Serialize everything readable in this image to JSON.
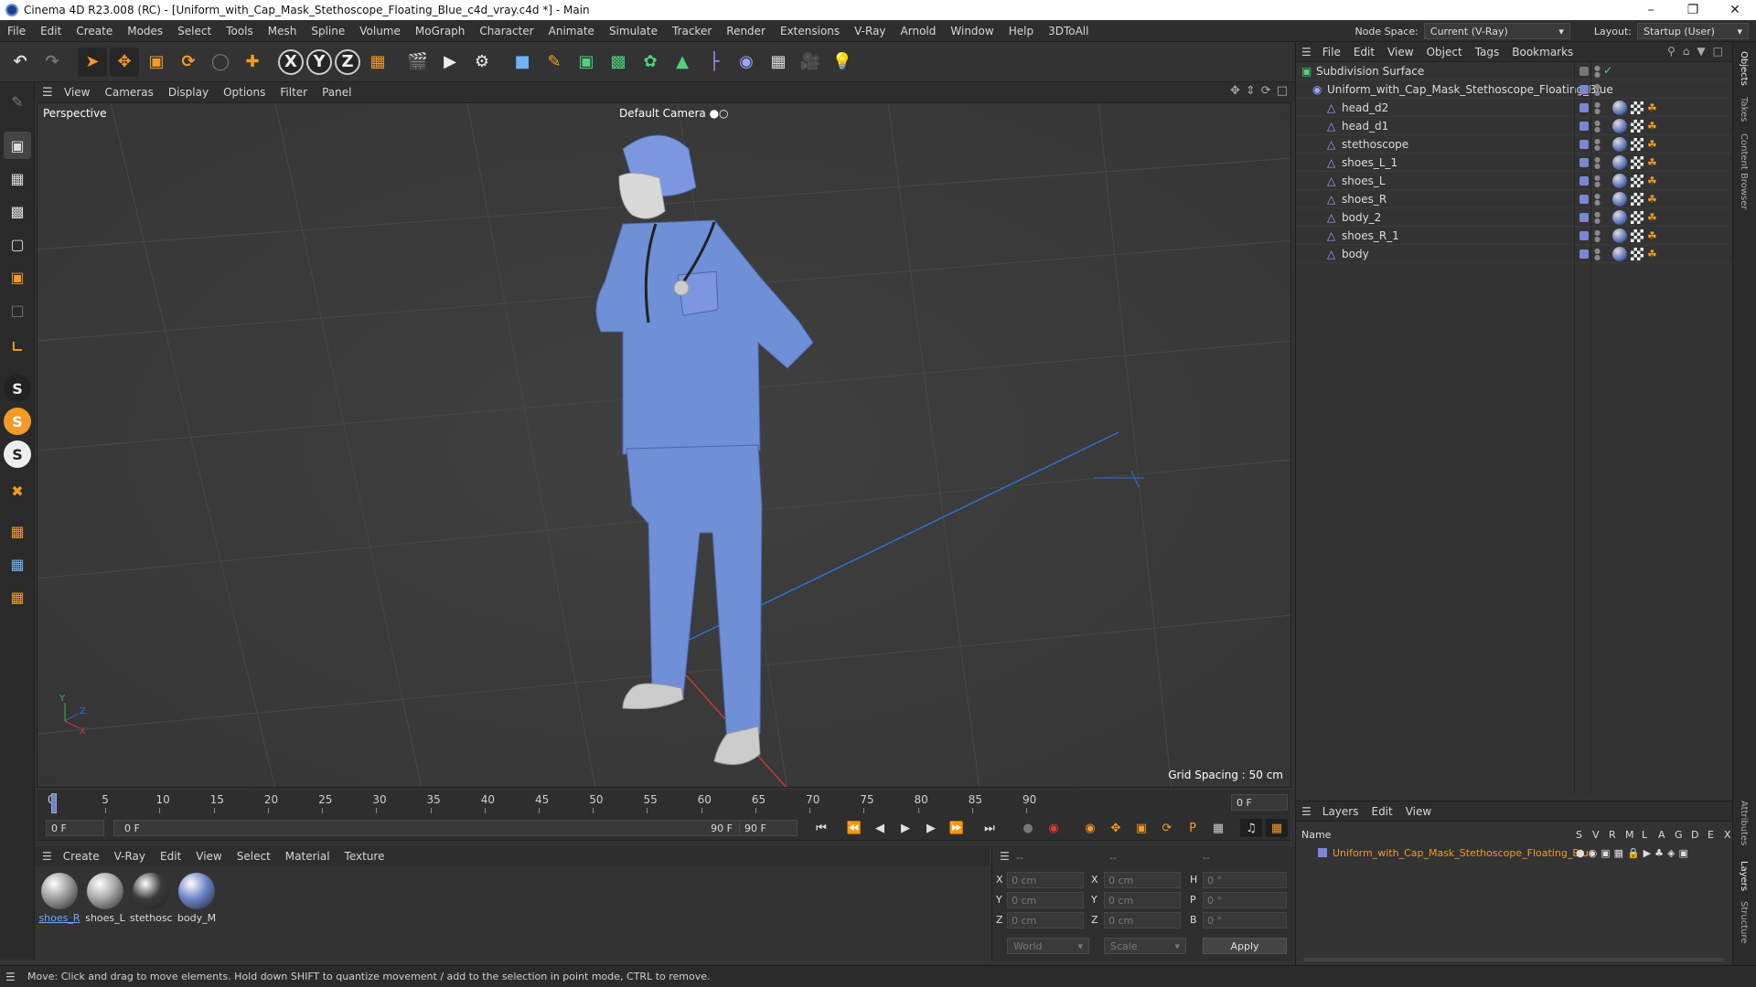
{
  "window": {
    "title": "Cinema 4D R23.008 (RC) - [Uniform_with_Cap_Mask_Stethoscope_Floating_Blue_c4d_vray.c4d *] - Main"
  },
  "menubar": {
    "items": [
      "File",
      "Edit",
      "Create",
      "Modes",
      "Select",
      "Tools",
      "Mesh",
      "Spline",
      "Volume",
      "MoGraph",
      "Character",
      "Animate",
      "Simulate",
      "Tracker",
      "Render",
      "Extensions",
      "V-Ray",
      "Arnold",
      "Window",
      "Help",
      "3DToAll"
    ]
  },
  "nodespace": {
    "label": "Node Space:",
    "value": "Current (V-Ray)",
    "layout_label": "Layout:",
    "layout_value": "Startup (User)"
  },
  "viewport": {
    "menu": [
      "View",
      "Cameras",
      "Display",
      "Options",
      "Filter",
      "Panel"
    ],
    "label": "Perspective",
    "camera": "Default Camera",
    "grid_spacing": "Grid Spacing : 50 cm"
  },
  "timeline": {
    "ticks": [
      "0",
      "5",
      "10",
      "15",
      "20",
      "25",
      "30",
      "35",
      "40",
      "45",
      "50",
      "55",
      "60",
      "65",
      "70",
      "75",
      "80",
      "85",
      "90"
    ],
    "current_frame": "0 F",
    "start": "0 F",
    "range_start": "0 F",
    "range_end": "90 F",
    "end": "90 F"
  },
  "material_menu": [
    "Create",
    "V-Ray",
    "Edit",
    "View",
    "Select",
    "Material",
    "Texture"
  ],
  "materials": [
    {
      "label": "shoes_R",
      "color": "#9a9a9a"
    },
    {
      "label": "shoes_L",
      "color": "#a5a5a5"
    },
    {
      "label": "stethosc",
      "color": "#3a3a3a"
    },
    {
      "label": "body_M",
      "color": "#6b84c8"
    }
  ],
  "coords": {
    "header": [
      "--",
      "--",
      "--"
    ],
    "rows": [
      {
        "a": "X",
        "v1": "0 cm",
        "b": "X",
        "v2": "0 cm",
        "c": "H",
        "v3": "0 °"
      },
      {
        "a": "Y",
        "v1": "0 cm",
        "b": "Y",
        "v2": "0 cm",
        "c": "P",
        "v3": "0 °"
      },
      {
        "a": "Z",
        "v1": "0 cm",
        "b": "Z",
        "v2": "0 cm",
        "c": "B",
        "v3": "0 °"
      }
    ],
    "mode1": "World",
    "mode2": "Scale",
    "apply": "Apply"
  },
  "object_manager": {
    "menu": [
      "File",
      "Edit",
      "View",
      "Object",
      "Tags",
      "Bookmarks"
    ],
    "objects": [
      {
        "name": "Subdivision Surface",
        "indent": 0
      },
      {
        "name": "Uniform_with_Cap_Mask_Stethoscope_Floating_Blue",
        "indent": 1
      },
      {
        "name": "head_d2",
        "indent": 2
      },
      {
        "name": "head_d1",
        "indent": 2
      },
      {
        "name": "stethoscope",
        "indent": 2
      },
      {
        "name": "shoes_L_1",
        "indent": 2
      },
      {
        "name": "shoes_L",
        "indent": 2
      },
      {
        "name": "shoes_R",
        "indent": 2
      },
      {
        "name": "body_2",
        "indent": 2
      },
      {
        "name": "shoes_R_1",
        "indent": 2
      },
      {
        "name": "body",
        "indent": 2
      }
    ]
  },
  "layers": {
    "menu": [
      "Layers",
      "Edit",
      "View"
    ],
    "columns": [
      "Name",
      "S",
      "V",
      "R",
      "M",
      "L",
      "A",
      "G",
      "D",
      "E",
      "X"
    ],
    "rows": [
      {
        "name": "Uniform_with_Cap_Mask_Stethoscope_Floating_Blue"
      }
    ]
  },
  "side_tabs": [
    "Objects",
    "Takes",
    "Content Browser",
    "Attributes",
    "Layers",
    "Structure"
  ],
  "status": {
    "text": "Move: Click and drag to move elements. Hold down SHIFT to quantize movement / add to the selection in point mode, CTRL to remove."
  }
}
